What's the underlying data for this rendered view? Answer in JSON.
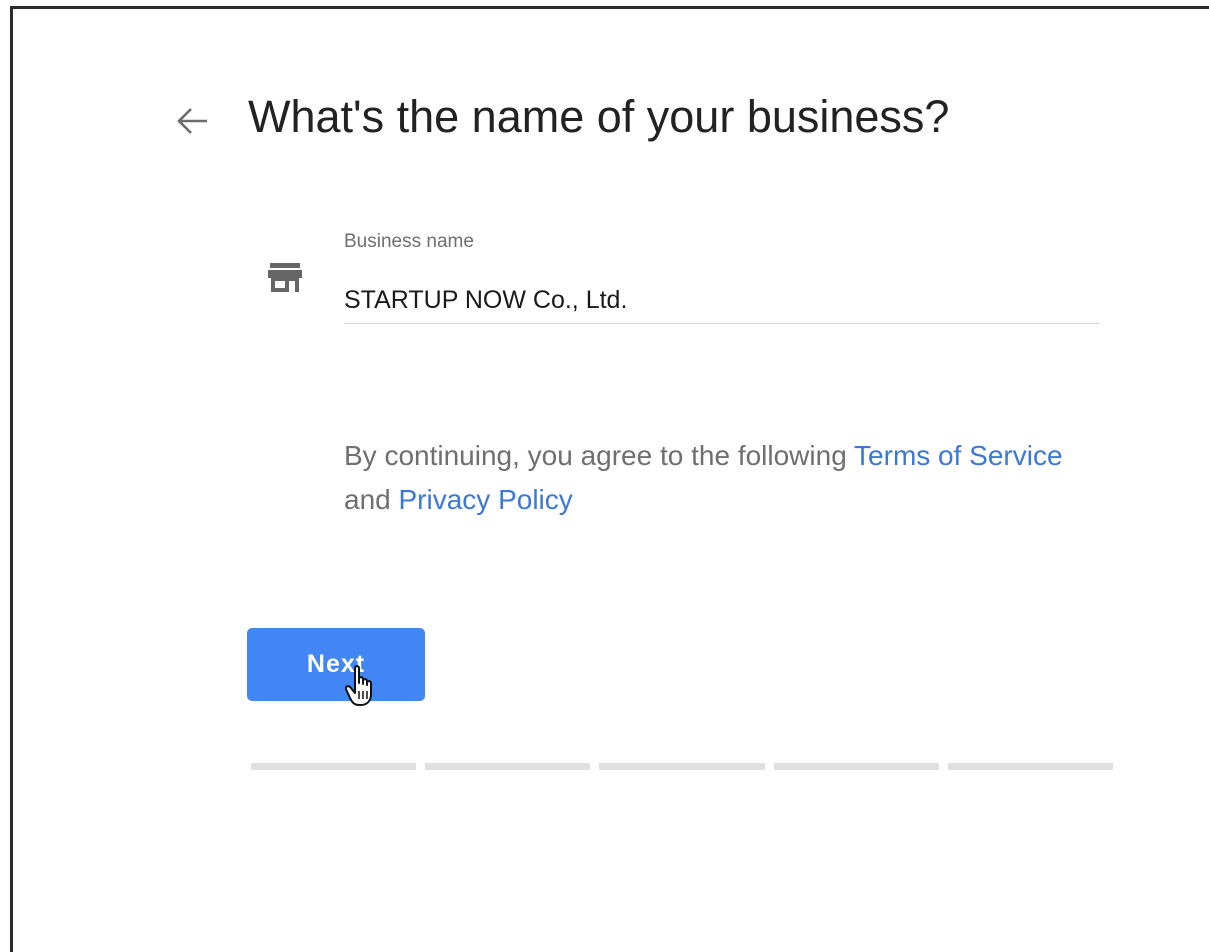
{
  "header": {
    "back_icon": "arrow-back-icon",
    "title": "What's the name of your business?"
  },
  "form": {
    "store_icon": "storefront-icon",
    "business_name_label": "Business name",
    "business_name_value": "STARTUP NOW Co., Ltd."
  },
  "terms": {
    "prefix": "By continuing, you agree to the following ",
    "terms_link": "Terms of Service",
    "conjunction": " and ",
    "privacy_link": "Privacy Policy"
  },
  "actions": {
    "next_label": "Next"
  },
  "progress": {
    "total_steps": 5
  },
  "colors": {
    "accent": "#4285f4",
    "link": "#3b78d8"
  }
}
